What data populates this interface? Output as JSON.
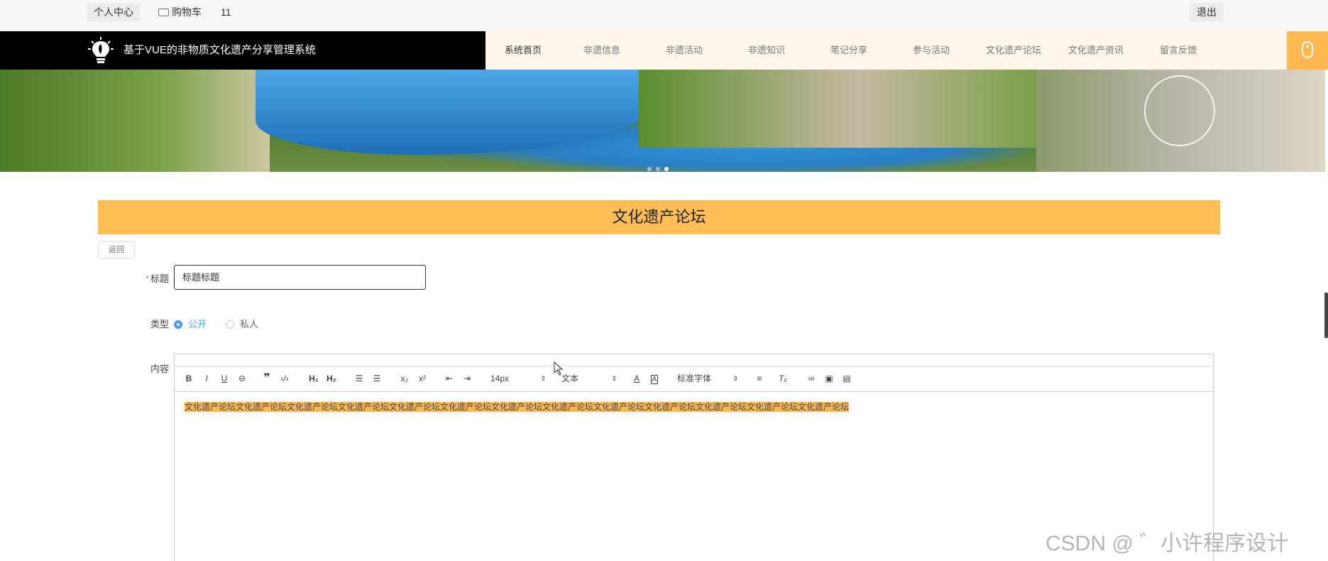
{
  "topbar": {
    "personal_center": "个人中心",
    "cart_label": "购物车",
    "cart_count": "11",
    "logout": "退出"
  },
  "nav": {
    "brand": "基于VUE的非物质文化遗产分享管理系统",
    "items": [
      {
        "label": "系统首页"
      },
      {
        "label": "非遗信息"
      },
      {
        "label": "非遗活动"
      },
      {
        "label": "非遗知识"
      },
      {
        "label": "笔记分享"
      },
      {
        "label": "参与活动"
      },
      {
        "label": "文化遗产论坛"
      },
      {
        "label": "文化遗产资讯"
      },
      {
        "label": "留言反馈"
      }
    ]
  },
  "banner": {
    "slide_count": 3,
    "active_slide": 3
  },
  "page": {
    "title": "文化遗产论坛",
    "back": "返回"
  },
  "form": {
    "title_label": "标题",
    "title_value": "标题标题",
    "type_label": "类型",
    "type_options": [
      "公开",
      "私人"
    ],
    "type_selected": "公开",
    "content_label": "内容",
    "toolbar": {
      "font_size": "14px",
      "header": "文本",
      "font_family": "标准字体"
    },
    "content_text": "文化遗产论坛文化遗产论坛文化遗产论坛文化遗产论坛文化遗产论坛文化遗产论坛文化遗产论坛文化遗产论坛文化遗产论坛文化遗产论坛文化遗产论坛文化遗产论坛文化遗产论坛"
  },
  "watermark": "CSDN @ ゛小许程序设计",
  "colors": {
    "accent": "#ffbd55",
    "nav_bg": "#000000",
    "menu_bg": "#fff7ec",
    "link_blue": "#409eff"
  }
}
